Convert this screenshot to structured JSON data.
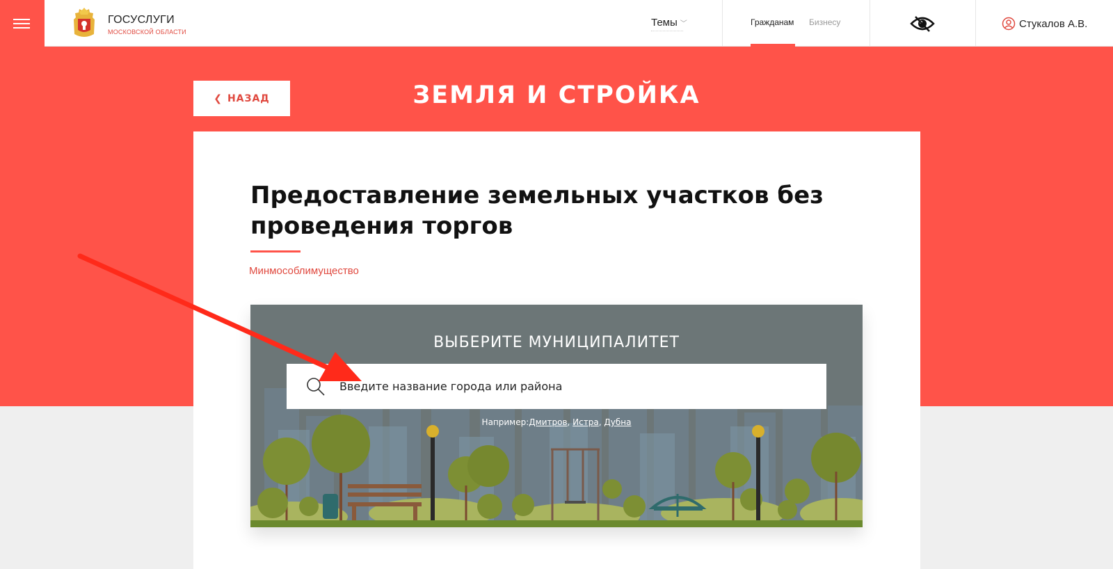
{
  "header": {
    "brand_title": "ГОСУСЛУГИ",
    "brand_subtitle": "МОСКОВСКОЙ ОБЛАСТИ",
    "themes_label": "Темы",
    "audience": {
      "citizens": "Гражданам",
      "business": "Бизнесу"
    },
    "user_name": "Стукалов А.В."
  },
  "hero": {
    "back_label": "НАЗАД",
    "title": "ЗЕМЛЯ И СТРОЙКА"
  },
  "service": {
    "title": "Предоставление земельных участков без проведения торгов",
    "department": "Минмособлимущество"
  },
  "municipality": {
    "heading": "ВЫБЕРИТЕ МУНИЦИПАЛИТЕТ",
    "search_placeholder": "Введите название города или района",
    "example_prefix": "Например:",
    "examples": [
      "Дмитров",
      "Истра",
      "Дубна"
    ]
  },
  "colors": {
    "accent": "#ff5349",
    "accent_text": "#e0493f",
    "banner_bg": "#6c7677"
  }
}
